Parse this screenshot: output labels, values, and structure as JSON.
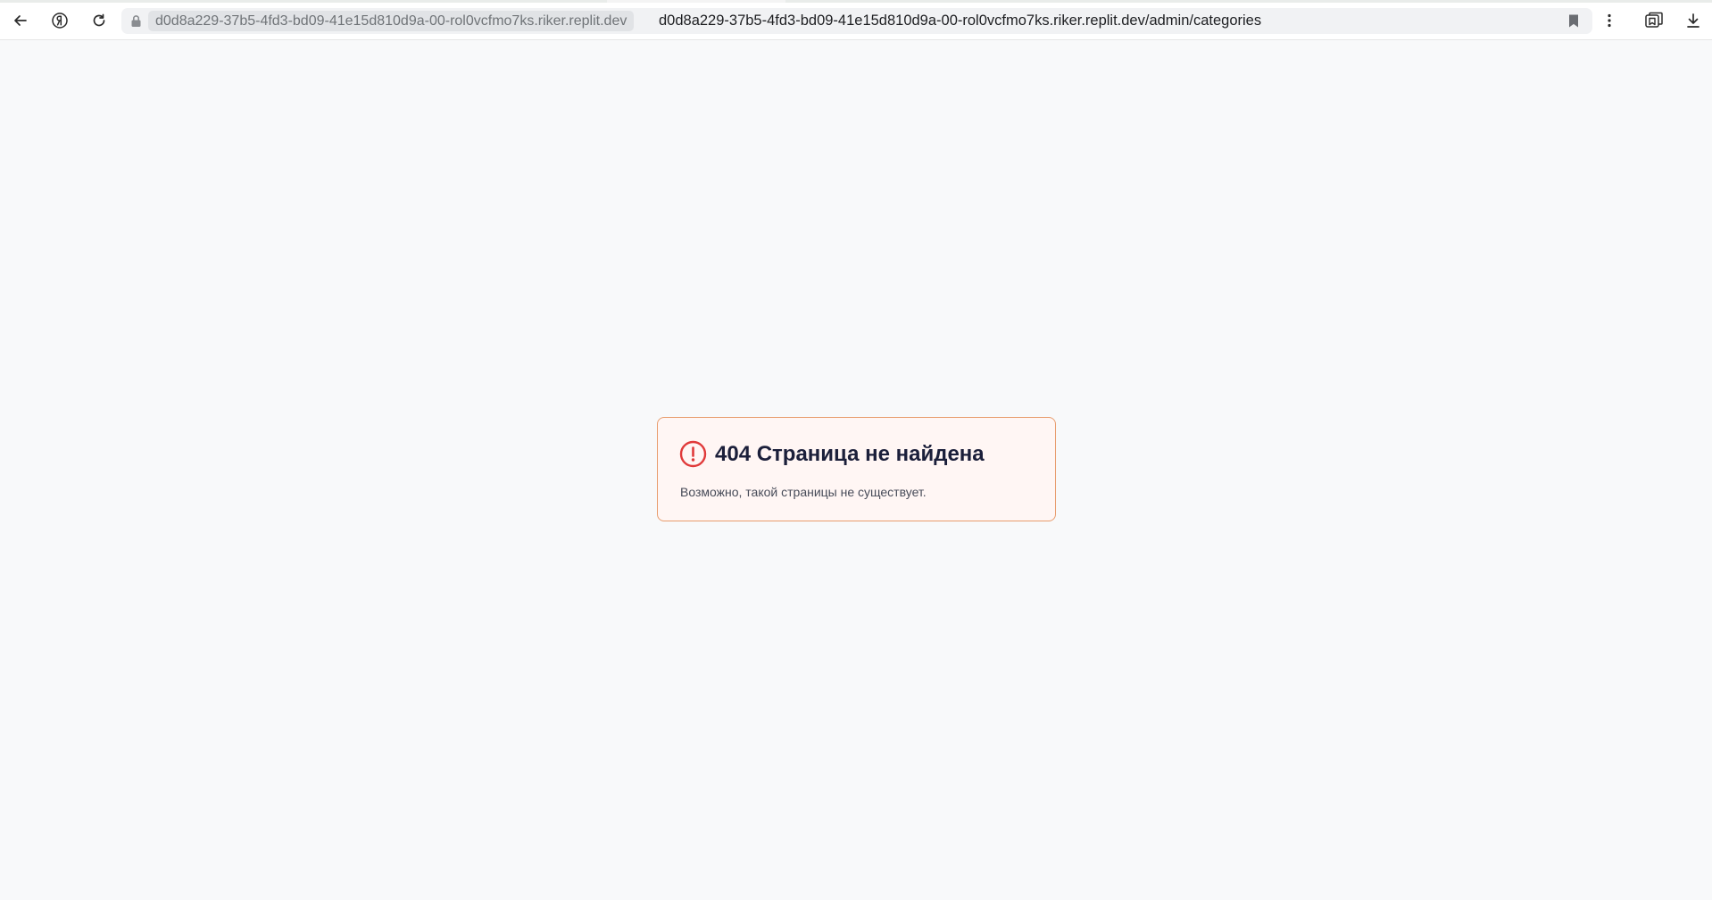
{
  "browser": {
    "domain_chip": "d0d8a229-37b5-4fd3-bd09-41e15d810d9a-00-rol0vcfmo7ks.riker.replit.dev",
    "url": "d0d8a229-37b5-4fd3-bd09-41e15d810d9a-00-rol0vcfmo7ks.riker.replit.dev/admin/categories",
    "icons": [
      "back-icon",
      "yandex-icon",
      "reload-icon",
      "lock-icon",
      "bookmark-icon",
      "more-icon",
      "collections-icon",
      "download-icon"
    ]
  },
  "error": {
    "title": "404 Страница не найдена",
    "description": "Возможно, такой страницы не существует.",
    "accent_color": "#e03a3a",
    "border_color": "#e89d6e"
  }
}
